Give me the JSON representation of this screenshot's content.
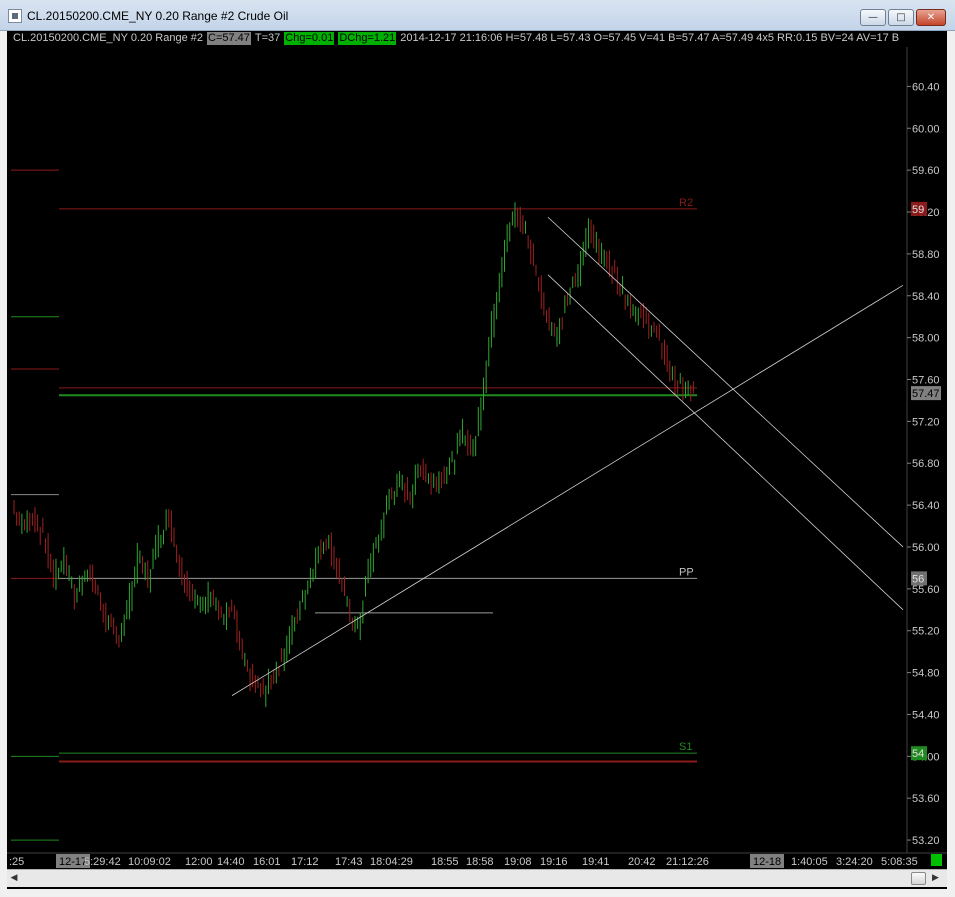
{
  "window": {
    "title": "CL.20150200.CME_NY  0.20 Range  #2  Crude Oil",
    "minimize_glyph": "—",
    "maximize_glyph": "□",
    "close_glyph": "✕"
  },
  "infobar": {
    "symbol": "CL.20150200.CME_NY  0.20 Range  #2",
    "close": "C=57.47",
    "ticks": "T=37",
    "chg": "Chg=0.01",
    "dchg": "DChg=1.21",
    "rest": "2014-12-17 21:16:06 H=57.48 L=57.43 O=57.45 V=41 B=57.47 A=57.49 4x5 RR:0.15 BV=24 AV=17 B"
  },
  "scrollbar": {
    "left_arrow": "◀",
    "right_arrow": "▶"
  },
  "colors": {
    "background": "#000000",
    "up_bar": "#2fa82f",
    "down_bar": "#a02020",
    "resistance": "#8b1a1a",
    "support": "#1f8a1f",
    "pivot": "#9a9a9a",
    "trendline": "#d0d0d0",
    "axis_text": "#c8c8c8"
  },
  "chart_data": {
    "type": "candlestick-range",
    "title": "CL.20150200.CME_NY  0.20 Range  #2  Crude Oil",
    "ylim": [
      53.0,
      60.7
    ],
    "y_ticks": [
      "60.40",
      "60.00",
      "59.60",
      "59.20",
      "58.80",
      "58.40",
      "58.00",
      "57.60",
      "57.20",
      "56.80",
      "56.40",
      "56.00",
      "55.60",
      "55.20",
      "54.80",
      "54.40",
      "54.00",
      "53.60",
      "53.20"
    ],
    "x_ticks": [
      ":25",
      "12-17",
      "5:29:42",
      "10:09:02",
      "12:00",
      "14:40",
      "16:01",
      "17:12",
      "17:43",
      "18:04:29",
      "18:55",
      "18:58",
      "19:08",
      "19:16",
      "19:41",
      "20:42",
      "21:12:26",
      "12-18",
      "1:40:05",
      "3:24:20",
      "5:08:35"
    ],
    "levels": [
      {
        "name": "R2",
        "value": 59.23,
        "axis_label": "59",
        "kind": "resistance"
      },
      {
        "name": "",
        "value": 57.52,
        "axis_label": "",
        "kind": "resistance"
      },
      {
        "name": "",
        "value": 57.45,
        "axis_label": "",
        "kind": "support"
      },
      {
        "name": "PP",
        "value": 55.7,
        "axis_label": "56",
        "kind": "pivot"
      },
      {
        "name": "S1",
        "value": 54.03,
        "axis_label": "54",
        "kind": "support"
      },
      {
        "name": "",
        "value": 53.95,
        "axis_label": "",
        "kind": "resistance"
      },
      {
        "name": "",
        "value": 55.37,
        "axis_label": "",
        "kind": "pivot"
      }
    ],
    "last_price": "57.47",
    "trendlines": [
      {
        "name": "uptrend",
        "from": [
          14.4,
          54.58
        ],
        "to": [
          5.1,
          58.5
        ]
      },
      {
        "name": "channel-upper",
        "from": [
          19.16,
          59.15
        ],
        "to": [
          5.1,
          56.0
        ]
      },
      {
        "name": "channel-lower",
        "from": [
          19.16,
          58.6
        ],
        "to": [
          5.1,
          55.4
        ]
      }
    ],
    "price_path": [
      56.4,
      56.2,
      56.3,
      56.1,
      55.7,
      55.9,
      55.5,
      55.8,
      55.6,
      55.3,
      55.1,
      55.4,
      55.9,
      55.7,
      56.1,
      56.3,
      55.8,
      55.6,
      55.4,
      55.6,
      55.3,
      55.4,
      54.9,
      54.7,
      54.6,
      54.8,
      55.0,
      55.3,
      55.6,
      55.9,
      56.1,
      55.8,
      55.4,
      55.2,
      55.8,
      56.1,
      56.5,
      56.6,
      56.5,
      56.8,
      56.6,
      56.7,
      56.8,
      57.1,
      56.9,
      57.6,
      58.3,
      58.9,
      59.2,
      59.0,
      58.6,
      58.2,
      58.0,
      58.4,
      58.6,
      59.1,
      58.8,
      58.7,
      58.5,
      58.3,
      58.2,
      58.1,
      57.9,
      57.6,
      57.5,
      57.47
    ]
  }
}
